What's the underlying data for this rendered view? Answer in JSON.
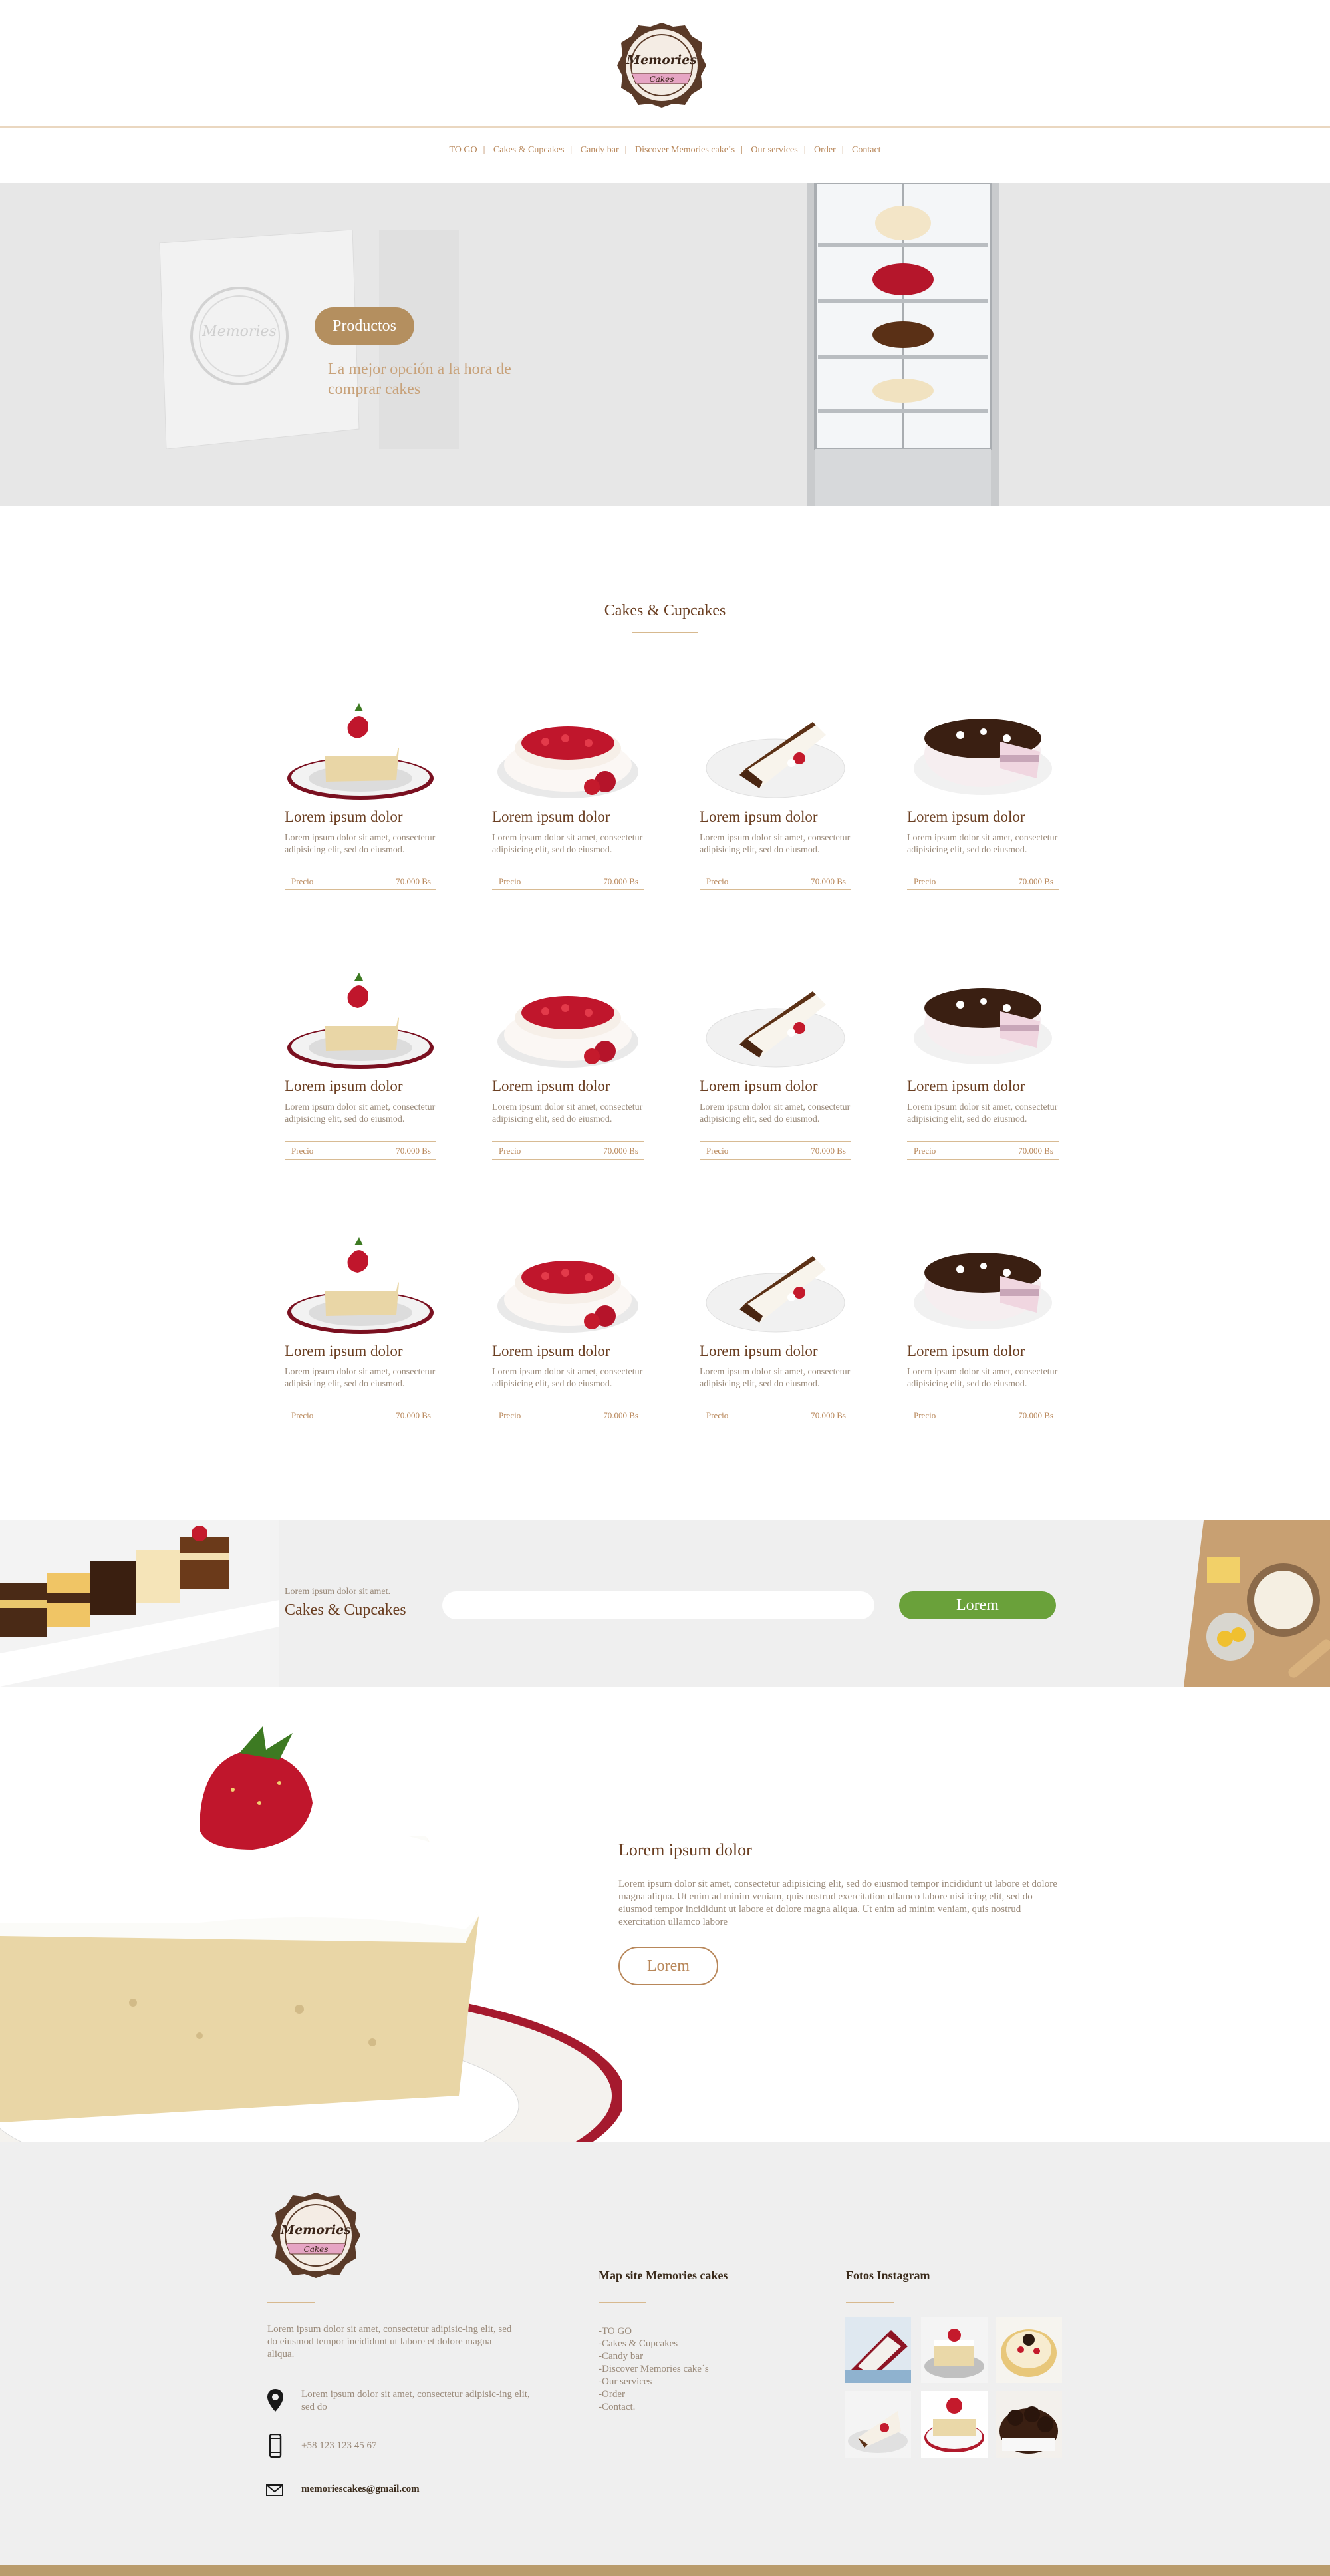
{
  "brand": {
    "logo_text": "Memories",
    "logo_sub": "Cakes"
  },
  "nav": [
    "TO GO",
    "Cakes & Cupcakes",
    "Candy bar",
    "Discover Memories cake´s",
    "Our services",
    "Order",
    "Contact"
  ],
  "hero": {
    "button": "Productos",
    "tagline": "La mejor opción a la hora de comprar cakes"
  },
  "section": {
    "title": "Cakes & Cupcakes"
  },
  "products": [
    {
      "name": "Lorem ipsum dolor",
      "desc": "Lorem ipsum dolor sit amet, consectetur adipisicing elit, sed do eiusmod.",
      "price_label": "Precio",
      "price": "70.000 Bs",
      "image": "tres-leches-icon"
    },
    {
      "name": "Lorem ipsum dolor",
      "desc": "Lorem ipsum dolor sit amet, consectetur adipisicing elit, sed do eiusmod.",
      "price_label": "Precio",
      "price": "70.000 Bs",
      "image": "strawberry-cake-icon"
    },
    {
      "name": "Lorem ipsum dolor",
      "desc": "Lorem ipsum dolor sit amet, consectetur adipisicing elit, sed do eiusmod.",
      "price_label": "Precio",
      "price": "70.000 Bs",
      "image": "cake-slice-icon"
    },
    {
      "name": "Lorem ipsum dolor",
      "desc": "Lorem ipsum dolor sit amet, consectetur adipisicing elit, sed do eiusmod.",
      "price_label": "Precio",
      "price": "70.000 Bs",
      "image": "chocolate-cake-icon"
    },
    {
      "name": "Lorem ipsum dolor",
      "desc": "Lorem ipsum dolor sit amet, consectetur adipisicing elit, sed do eiusmod.",
      "price_label": "Precio",
      "price": "70.000 Bs",
      "image": "tres-leches-icon"
    },
    {
      "name": "Lorem ipsum dolor",
      "desc": "Lorem ipsum dolor sit amet, consectetur adipisicing elit, sed do eiusmod.",
      "price_label": "Precio",
      "price": "70.000 Bs",
      "image": "strawberry-cake-icon"
    },
    {
      "name": "Lorem ipsum dolor",
      "desc": "Lorem ipsum dolor sit amet, consectetur adipisicing elit, sed do eiusmod.",
      "price_label": "Precio",
      "price": "70.000 Bs",
      "image": "cake-slice-icon"
    },
    {
      "name": "Lorem ipsum dolor",
      "desc": "Lorem ipsum dolor sit amet, consectetur adipisicing elit, sed do eiusmod.",
      "price_label": "Precio",
      "price": "70.000 Bs",
      "image": "chocolate-cake-icon"
    },
    {
      "name": "Lorem ipsum dolor",
      "desc": "Lorem ipsum dolor sit amet, consectetur adipisicing elit, sed do eiusmod.",
      "price_label": "Precio",
      "price": "70.000 Bs",
      "image": "tres-leches-icon"
    },
    {
      "name": "Lorem ipsum dolor",
      "desc": "Lorem ipsum dolor sit amet, consectetur adipisicing elit, sed do eiusmod.",
      "price_label": "Precio",
      "price": "70.000 Bs",
      "image": "strawberry-cake-icon"
    },
    {
      "name": "Lorem ipsum dolor",
      "desc": "Lorem ipsum dolor sit amet, consectetur adipisicing elit, sed do eiusmod.",
      "price_label": "Precio",
      "price": "70.000 Bs",
      "image": "cake-slice-icon"
    },
    {
      "name": "Lorem ipsum dolor",
      "desc": "Lorem ipsum dolor sit amet, consectetur adipisicing elit, sed do eiusmod.",
      "price_label": "Precio",
      "price": "70.000 Bs",
      "image": "chocolate-cake-icon"
    }
  ],
  "newsletter": {
    "small": "Lorem ipsum dolor sit amet.",
    "title": "Cakes & Cupcakes",
    "input_value": "",
    "button": "Lorem"
  },
  "feature": {
    "title": "Lorem ipsum dolor",
    "text": "Lorem ipsum dolor sit amet, consectetur adipisicing elit, sed do eiusmod tempor incididunt ut labore et dolore magna aliqua. Ut enim ad minim veniam, quis nostrud exercitation ullamco labore nisi icing elit, sed do eiusmod tempor incididunt ut labore et dolore magna aliqua. Ut enim ad minim veniam, quis nostrud exercitation ullamco labore",
    "button": "Lorem"
  },
  "footer": {
    "about": "Lorem ipsum dolor sit amet, consectetur adipisic-ing elit, sed do eiusmod tempor incididunt ut labore et dolore magna aliqua.",
    "address": "Lorem ipsum dolor sit amet, consectetur adipisic-ing elit, sed do",
    "phone": "+58 123 123 45 67",
    "email": "memoriescakes@gmail.com",
    "map_title": "Map site Memories cakes",
    "map_links": [
      "-TO GO",
      "-Cakes & Cupcakes",
      "-Candy bar",
      "-Discover Memories cake´s",
      "-Our services",
      "-Order",
      "-Contact."
    ],
    "insta_title": "Fotos Instagram"
  },
  "colors": {
    "brand_brown": "#b48f5f",
    "dark_brown": "#6b3f22",
    "green": "#6aa13a",
    "footer_bg": "#efefef",
    "footer_bar": "#b99c6c"
  }
}
